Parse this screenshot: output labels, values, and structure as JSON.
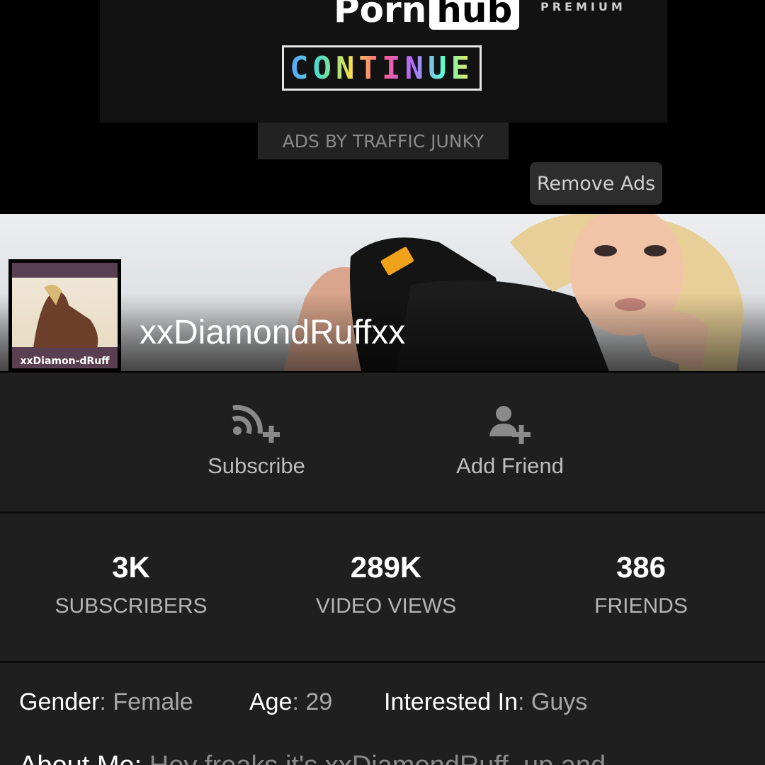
{
  "ad": {
    "logo_porn": "Porn",
    "logo_hub": "hub",
    "logo_premium": "PREMIUM",
    "continue_label": "CONTINUE",
    "ads_by": "ADS BY TRAFFIC JUNKY",
    "remove_ads": "Remove Ads"
  },
  "profile": {
    "username": "xxDiamondRuffxx",
    "avatar_caption": "xxDiamon-dRuff"
  },
  "actions": {
    "subscribe": "Subscribe",
    "add_friend": "Add Friend"
  },
  "stats": [
    {
      "value": "3K",
      "label": "SUBSCRIBERS"
    },
    {
      "value": "289K",
      "label": "VIDEO VIEWS"
    },
    {
      "value": "386",
      "label": "FRIENDS"
    }
  ],
  "info": {
    "gender_key": "Gender",
    "gender_value": "Female",
    "age_key": "Age",
    "age_value": "29",
    "interested_key": "Interested In",
    "interested_value": "Guys",
    "about_key": "About Me:",
    "about_value": "Hey freaks it's xxDiamondRuff, up and"
  },
  "colors": {
    "background": "#000000",
    "panel": "#1f1f1f",
    "muted_text": "#b5b5b5"
  }
}
